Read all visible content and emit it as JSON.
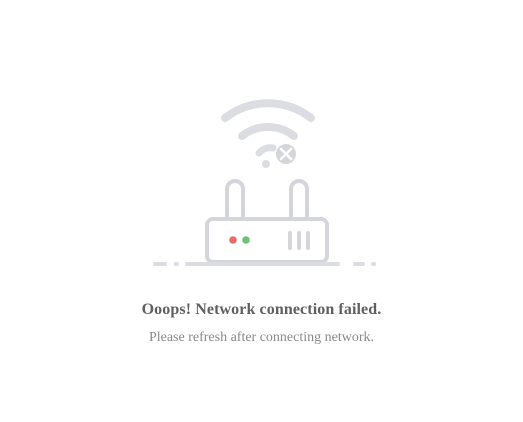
{
  "icons": {
    "wifi": "wifi-icon",
    "disconnect": "close-circle-icon",
    "router": "router-icon"
  },
  "colors": {
    "icon_stroke": "#dcdde2",
    "led_red": "#e76c6c",
    "led_green": "#6cc27b",
    "title": "#5f5f5f",
    "subtitle": "#8a8a8a"
  },
  "message": {
    "title": "Ooops! Network connection failed.",
    "subtitle": "Please refresh after connecting network."
  }
}
